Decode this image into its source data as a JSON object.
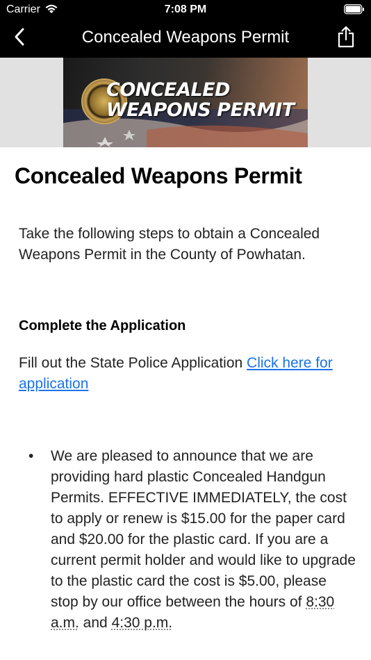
{
  "status_bar": {
    "carrier": "Carrier",
    "time": "7:08 PM"
  },
  "nav": {
    "title": "Concealed Weapons Permit",
    "back_icon": "chevron-left-icon",
    "share_icon": "share-icon"
  },
  "banner": {
    "text_line1": "CONCEALED",
    "text_line2": "WEAPONS PERMIT",
    "seal_text": "COMMONWEALTH OF VIRGINIA"
  },
  "content": {
    "title": "Concealed Weapons Permit",
    "intro": "Take the following steps to obtain a Concealed Weapons Permit in the County of Powhatan.",
    "section_heading": "Complete the Application",
    "application_text": "Fill out the State Police Application ",
    "application_link": "Click here for application",
    "bullets": [
      {
        "text_a": "We are pleased to announce that we are providing hard plastic Concealed Handgun Permits. EFFECTIVE IMMEDIATELY, the cost to apply or renew is $15.00 for the paper card and $20.00 for the plastic card. If you are a current permit holder and would like to upgrade to the plastic card the cost is $5.00, please stop by our office between the hours of ",
        "time_start": "8:30 a.m.",
        "text_b": " and ",
        "time_end": "4:30 p.m."
      }
    ]
  },
  "colors": {
    "link": "#1a73e8",
    "nav_background": "#000000",
    "banner_background": "#e1e1e1"
  }
}
